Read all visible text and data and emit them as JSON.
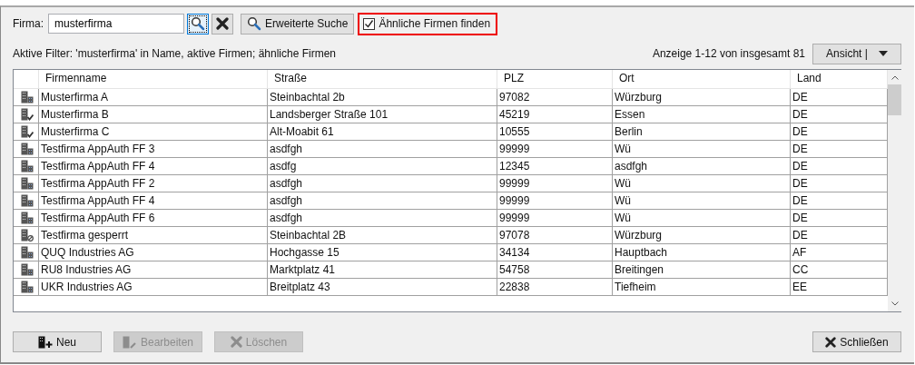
{
  "search": {
    "label": "Firma:",
    "value": "musterfirma"
  },
  "toolbar": {
    "extended_search": "Erweiterte Suche",
    "similar": {
      "label": "Ähnliche Firmen finden",
      "checked": true
    }
  },
  "filter_text": "Aktive Filter: 'musterfirma' in Name,  aktive Firmen; ähnliche Firmen",
  "paging": "Anzeige 1-12 von insgesamt 81",
  "view_button": "Ansicht |",
  "table": {
    "columns": [
      "Firmenname",
      "Straße",
      "PLZ",
      "Ort",
      "Land"
    ],
    "rows": [
      {
        "kind": "active",
        "cells": [
          "Musterfirma A",
          "Steinbachtal 2b",
          "97082",
          "Würzburg",
          "DE"
        ]
      },
      {
        "kind": "verified",
        "cells": [
          "Musterfirma B",
          "Landsberger Straße 101",
          "45219",
          "Essen",
          "DE"
        ]
      },
      {
        "kind": "verified",
        "cells": [
          "Musterfirma C",
          "Alt-Moabit 61",
          "10555",
          "Berlin",
          "DE"
        ]
      },
      {
        "kind": "active",
        "cells": [
          "Testfirma AppAuth FF 3",
          "asdfgh",
          "99999",
          "Wü",
          "DE"
        ]
      },
      {
        "kind": "active",
        "cells": [
          "Testfirma AppAuth FF 4",
          "asdfg",
          "12345",
          "asdfgh",
          "DE"
        ]
      },
      {
        "kind": "active",
        "cells": [
          "Testfirma AppAuth FF 2",
          "asdfgh",
          "99999",
          "Wü",
          "DE"
        ]
      },
      {
        "kind": "active",
        "cells": [
          "Testfirma AppAuth FF 4",
          "asdfgh",
          "99999",
          "Wü",
          "DE"
        ]
      },
      {
        "kind": "active",
        "cells": [
          "Testfirma AppAuth FF 6",
          "asdfgh",
          "99999",
          "Wü",
          "DE"
        ]
      },
      {
        "kind": "locked",
        "cells": [
          "Testfirma gesperrt",
          "Steinbachtal 2B",
          "97078",
          "Würzburg",
          "DE"
        ]
      },
      {
        "kind": "active",
        "cells": [
          "QUQ Industries AG",
          "Hochgasse 15",
          "34134",
          "Hauptbach",
          "AF"
        ]
      },
      {
        "kind": "active",
        "cells": [
          "RU8 Industries AG",
          "Marktplatz 41",
          "54758",
          "Breitingen",
          "CC"
        ]
      },
      {
        "kind": "active",
        "cells": [
          "UKR Industries AG",
          "Breitplatz 43",
          "22838",
          "Tiefheim",
          "EE"
        ]
      }
    ]
  },
  "buttons": [
    {
      "kind": "new",
      "label": "Neu",
      "disabled": false
    },
    {
      "kind": "edit",
      "label": "Bearbeiten",
      "disabled": true
    },
    {
      "kind": "delete",
      "label": "Löschen",
      "disabled": true
    }
  ],
  "close_button": "Schließen"
}
